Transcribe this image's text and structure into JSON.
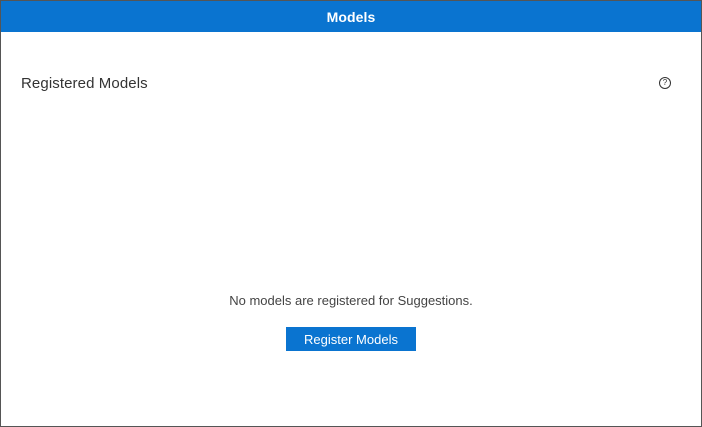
{
  "window": {
    "title": "Models"
  },
  "panel": {
    "title": "Registered Models",
    "help_icon_glyph": "?",
    "help_icon": "help-circle-icon"
  },
  "empty_state": {
    "message": "No models are registered for Suggestions.",
    "register_button_label": "Register Models"
  },
  "colors": {
    "accent": "#0a74d0",
    "border": "#555555",
    "text": "#333333"
  }
}
